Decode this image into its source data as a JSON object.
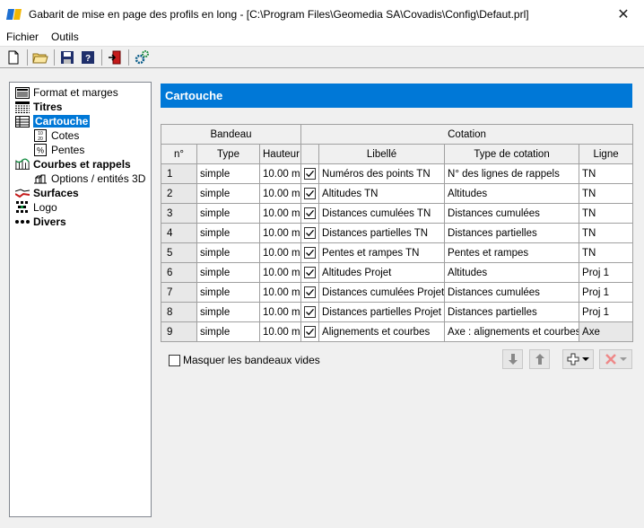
{
  "window": {
    "title": "Gabarit de mise en page des profils en long - [C:\\Program Files\\Geomedia SA\\Covadis\\Config\\Defaut.prl]",
    "close_glyph": "✕"
  },
  "menu": [
    "Fichier",
    "Outils"
  ],
  "tree": {
    "items": [
      {
        "label": "Format et marges",
        "icon": "page-layout-icon",
        "bold": false
      },
      {
        "label": "Titres",
        "icon": "titles-icon",
        "bold": true
      },
      {
        "label": "Cartouche",
        "icon": "table-icon",
        "bold": true,
        "selected": true
      },
      {
        "label": "Cotes",
        "icon": "dimension-icon",
        "bold": false
      },
      {
        "label": "Pentes",
        "icon": "percent-slope-icon",
        "bold": false
      },
      {
        "label": "Courbes et rappels",
        "icon": "curves-icon",
        "bold": true
      },
      {
        "label": "Options / entités 3D",
        "icon": "3d-options-icon",
        "bold": false
      },
      {
        "label": "Surfaces",
        "icon": "surfaces-icon",
        "bold": true
      },
      {
        "label": "Logo",
        "icon": "logo-icon",
        "bold": false
      },
      {
        "label": "Divers",
        "icon": "ellipsis-icon",
        "bold": true
      }
    ]
  },
  "panel": {
    "title": "Cartouche"
  },
  "grid": {
    "group_headers": [
      "Bandeau",
      "Cotation"
    ],
    "columns": [
      "n°",
      "Type",
      "Hauteur",
      "Libellé",
      "Type de cotation",
      "Ligne"
    ],
    "rows": [
      {
        "n": "1",
        "type": "simple",
        "hauteur": "10.00 m",
        "checked": true,
        "libelle": "Numéros des points TN",
        "type_cotation": "N° des lignes de rappels",
        "ligne": "TN"
      },
      {
        "n": "2",
        "type": "simple",
        "hauteur": "10.00 m",
        "checked": true,
        "libelle": "Altitudes TN",
        "type_cotation": "Altitudes",
        "ligne": "TN"
      },
      {
        "n": "3",
        "type": "simple",
        "hauteur": "10.00 m",
        "checked": true,
        "libelle": "Distances cumulées TN",
        "type_cotation": "Distances cumulées",
        "ligne": "TN"
      },
      {
        "n": "4",
        "type": "simple",
        "hauteur": "10.00 m",
        "checked": true,
        "libelle": "Distances partielles TN",
        "type_cotation": "Distances partielles",
        "ligne": "TN"
      },
      {
        "n": "5",
        "type": "simple",
        "hauteur": "10.00 m",
        "checked": true,
        "libelle": "Pentes et rampes TN",
        "type_cotation": "Pentes et rampes",
        "ligne": "TN"
      },
      {
        "n": "6",
        "type": "simple",
        "hauteur": "10.00 m",
        "checked": true,
        "libelle": "Altitudes Projet",
        "type_cotation": "Altitudes",
        "ligne": "Proj  1"
      },
      {
        "n": "7",
        "type": "simple",
        "hauteur": "10.00 m",
        "checked": true,
        "libelle": "Distances cumulées Projet",
        "type_cotation": "Distances cumulées",
        "ligne": "Proj  1"
      },
      {
        "n": "8",
        "type": "simple",
        "hauteur": "10.00 m",
        "checked": true,
        "libelle": "Distances partielles Projet",
        "type_cotation": "Distances partielles",
        "ligne": "Proj  1"
      },
      {
        "n": "9",
        "type": "simple",
        "hauteur": "10.00 m",
        "checked": true,
        "libelle": "Alignements et courbes",
        "type_cotation": "Axe : alignements et courbes",
        "ligne": "Axe",
        "ligne_gray": true
      }
    ]
  },
  "footer": {
    "hide_empty_label": "Masquer les bandeaux vides",
    "hide_empty_checked": false
  },
  "colors": {
    "accent": "#0078d7",
    "delete_red": "#e81123",
    "add_green": "#1a8a1a"
  }
}
